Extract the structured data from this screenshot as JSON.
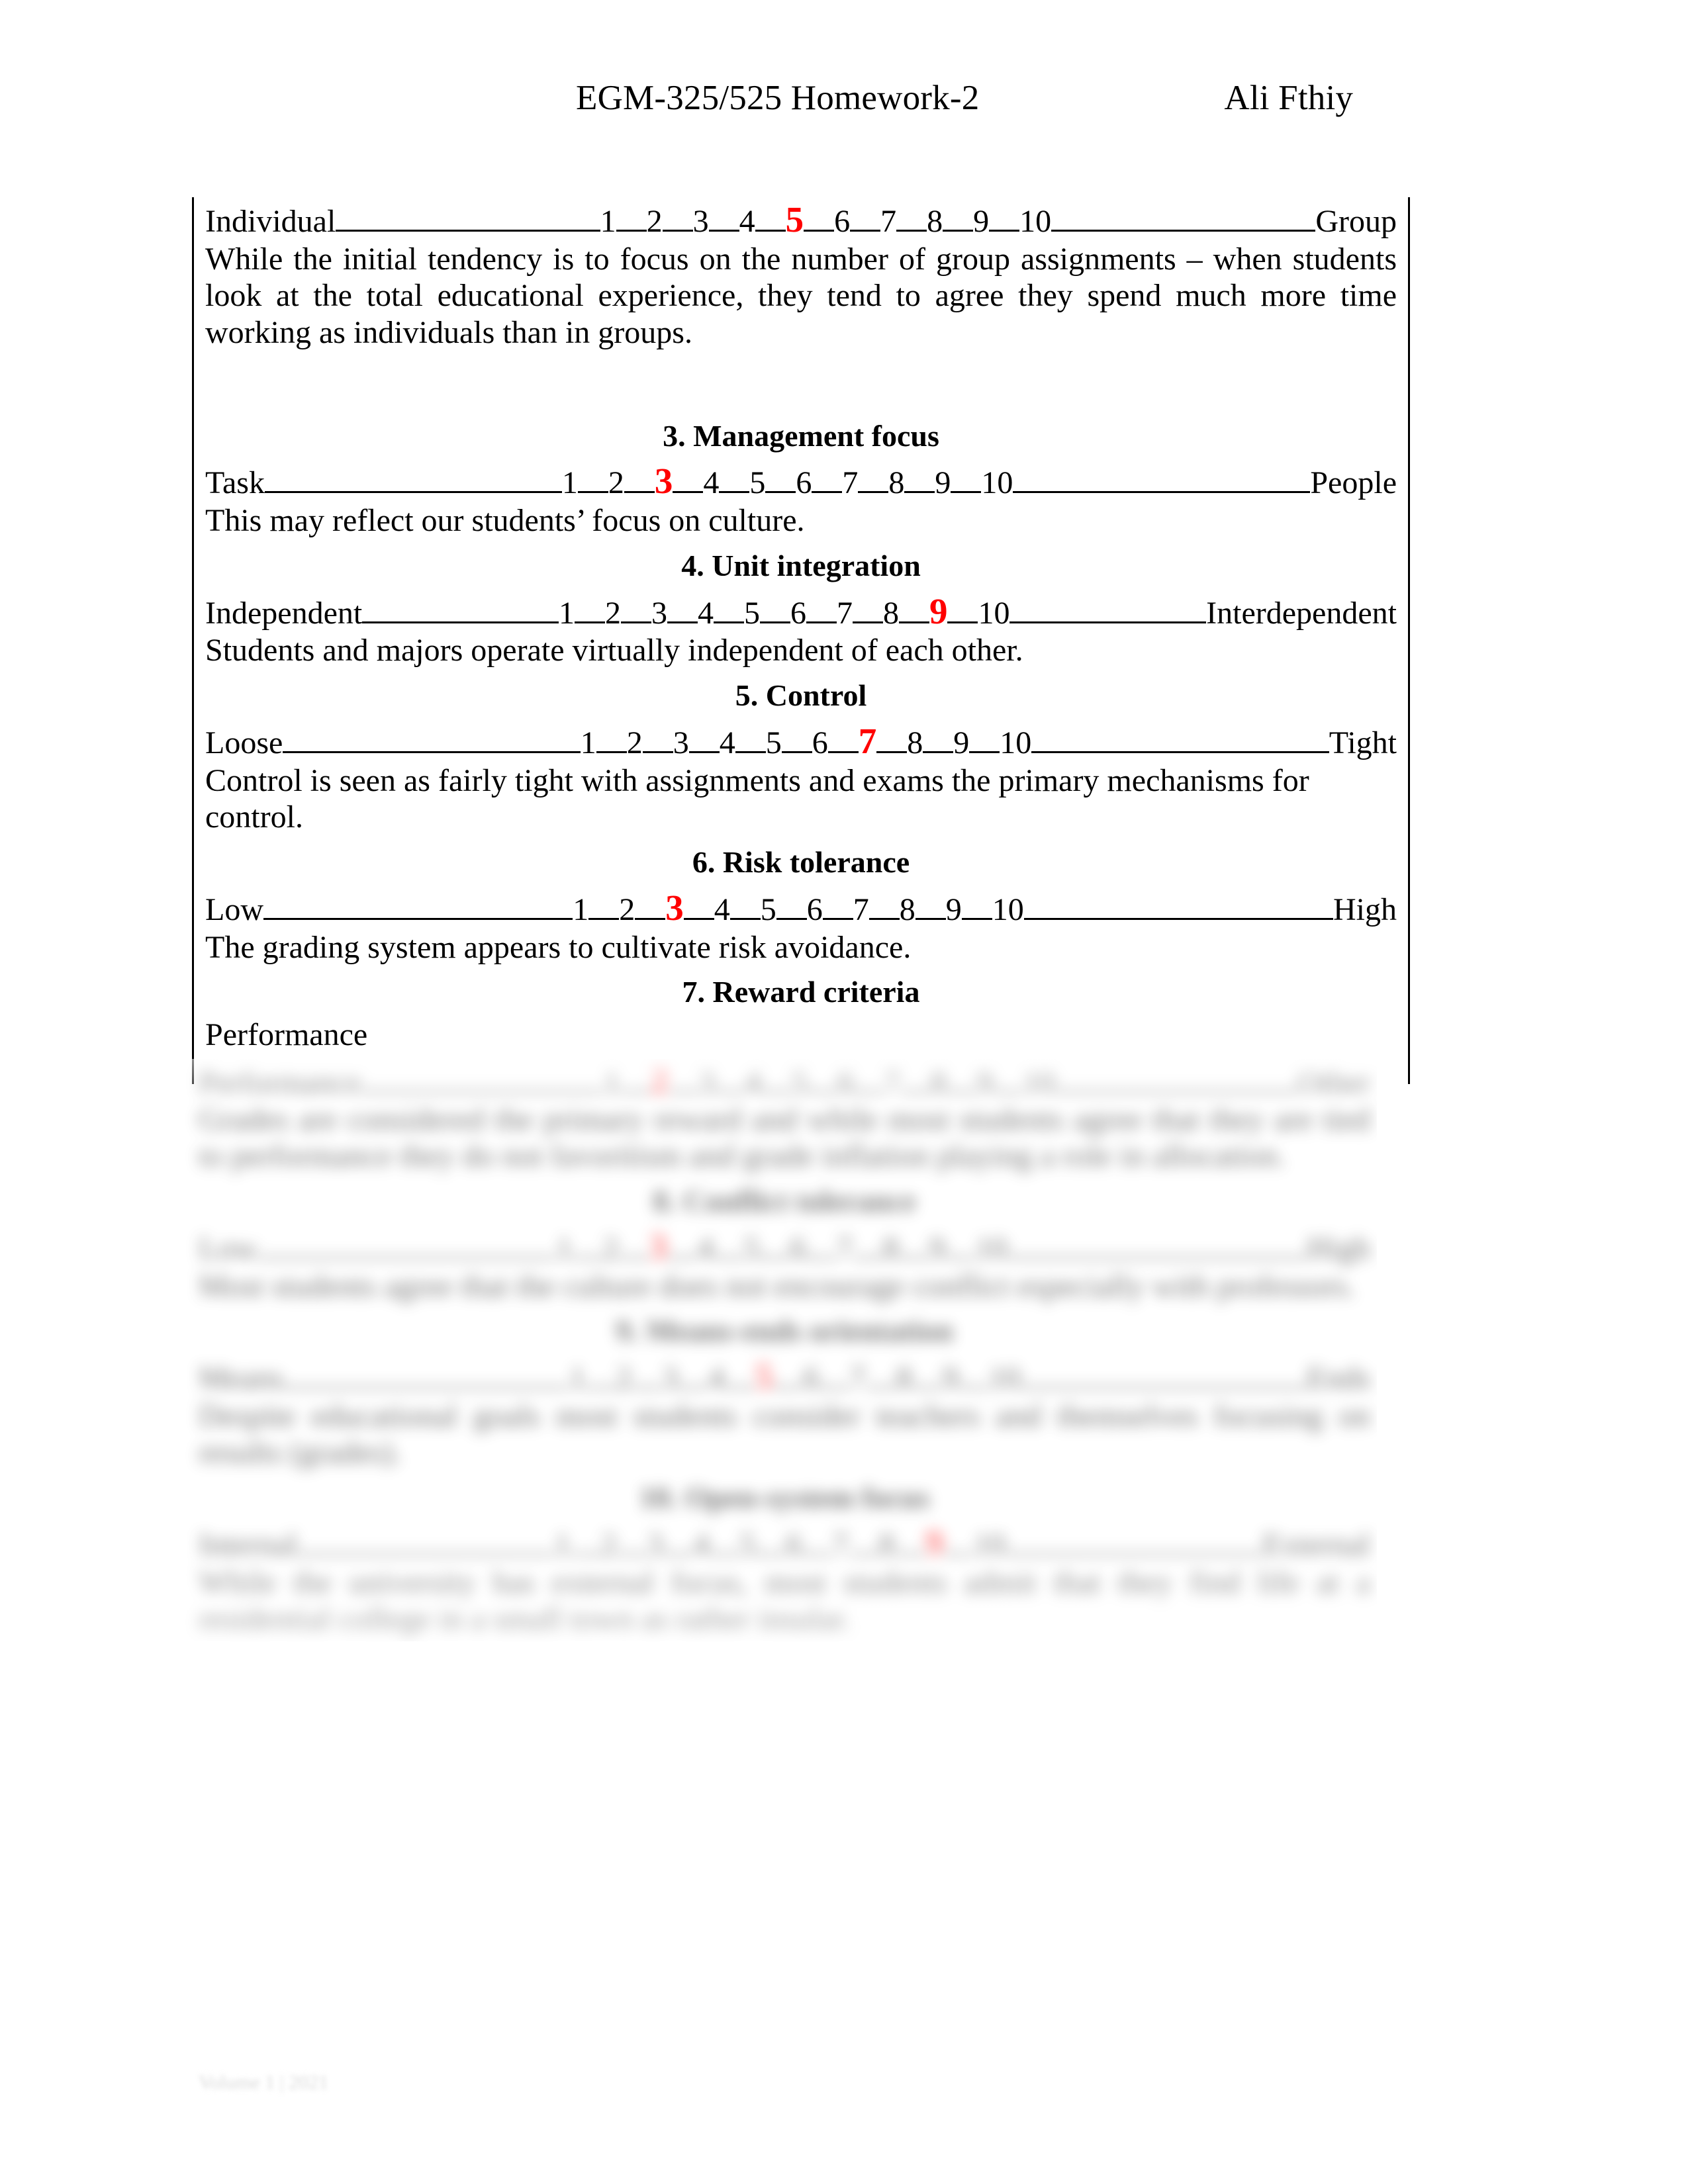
{
  "header": {
    "title": "EGM-325/525 Homework-2",
    "author": "Ali Fthiy"
  },
  "scale_numbers": [
    "1",
    "2",
    "3",
    "4",
    "5",
    "6",
    "7",
    "8",
    "9",
    "10"
  ],
  "sections": [
    {
      "id": "sec-2-individual-group",
      "heading": "",
      "scale": {
        "left_anchor": "Individual",
        "right_anchor": "Group",
        "selected": 5
      },
      "body": "While the initial tendency is to focus on the number of group assignments – when students look at the total educational experience, they tend to agree they spend much more time working as individuals than in groups."
    },
    {
      "id": "sec-3-management-focus",
      "heading": "3. Management focus",
      "scale": {
        "left_anchor": "Task",
        "right_anchor": "People",
        "selected": 3
      },
      "body": "This may reflect our students’ focus on culture."
    },
    {
      "id": "sec-4-unit-integration",
      "heading": "4. Unit integration",
      "scale": {
        "left_anchor": "Independent",
        "right_anchor": "Interdependent",
        "selected": 9
      },
      "body": "Students and majors operate virtually independent of each other."
    },
    {
      "id": "sec-5-control",
      "heading": "5. Control",
      "scale": {
        "left_anchor": "Loose",
        "right_anchor": "Tight",
        "selected": 7
      },
      "body": "Control is seen as fairly tight with assignments and exams the primary mechanisms for control."
    },
    {
      "id": "sec-6-risk-tolerance",
      "heading": "6. Risk tolerance",
      "scale": {
        "left_anchor": "Low",
        "right_anchor": "High",
        "selected": 3
      },
      "body": "The grading system appears to cultivate risk avoidance."
    },
    {
      "id": "sec-7-reward-criteria",
      "heading": "7. Reward criteria",
      "scale": {
        "left_anchor": "Performance",
        "right_anchor": "Other",
        "selected": 2
      },
      "body": "Grades are considered the primary reward and while most students agree that they are tied to performance they do not favoritism and grade inflation playing a role in allocation."
    },
    {
      "id": "sec-8-conflict-tolerance",
      "heading": "8. Conflict tolerance",
      "scale": {
        "left_anchor": "Low",
        "right_anchor": "High",
        "selected": 3
      },
      "body": "Most students agree that the culture does not encourage conflict especially with professors."
    },
    {
      "id": "sec-9-means-ends-orientation",
      "heading": "9. Means-ends orientation",
      "scale": {
        "left_anchor": "Means",
        "right_anchor": "Ends",
        "selected": 5
      },
      "body": "Despite educational goals most students consider teachers and themselves focusing on results (grades)."
    },
    {
      "id": "sec-10-open-system-focus",
      "heading": "10. Open-system focus",
      "scale": {
        "left_anchor": "Internal",
        "right_anchor": "External",
        "selected": 9
      },
      "body": "While the university has external focus, most students admit that they find life at a residential college in a small town as rather insular."
    }
  ],
  "footer": {
    "note": "Volume 1 | 2021"
  },
  "colors": {
    "selected_value": "#ff0000",
    "text": "#000000",
    "rule": "#000000"
  }
}
